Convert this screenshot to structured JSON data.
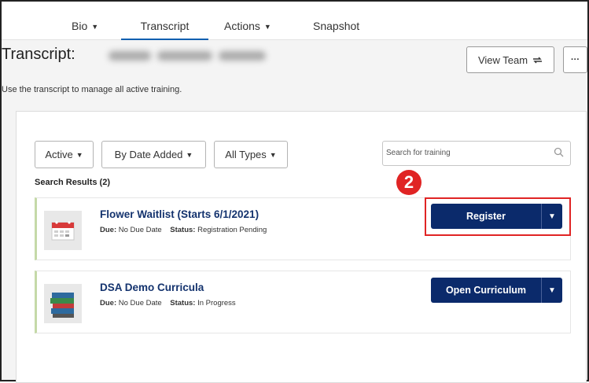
{
  "nav": {
    "items": [
      {
        "label": "Bio",
        "has_caret": true
      },
      {
        "label": "Transcript",
        "has_caret": false,
        "active": true
      },
      {
        "label": "Actions",
        "has_caret": true
      },
      {
        "label": "Snapshot",
        "has_caret": false
      }
    ]
  },
  "header": {
    "title": "Transcript:",
    "view_team_label": "View Team",
    "more_label": "···",
    "description": "Use the transcript to manage all active training."
  },
  "filters": {
    "status": "Active",
    "sort": "By Date Added",
    "type": "All Types"
  },
  "search": {
    "placeholder": "Search for training"
  },
  "results": {
    "label": "Search Results (2)",
    "items": [
      {
        "title": "Flower Waitlist (Starts 6/1/2021)",
        "due_label": "Due:",
        "due_value": "No Due Date",
        "status_label": "Status:",
        "status_value": "Registration Pending",
        "action_label": "Register",
        "icon": "calendar-icon"
      },
      {
        "title": "DSA Demo Curricula",
        "due_label": "Due:",
        "due_value": "No Due Date",
        "status_label": "Status:",
        "status_value": "In Progress",
        "action_label": "Open Curriculum",
        "icon": "books-icon"
      }
    ]
  },
  "annotation": {
    "step_number": "2"
  },
  "colors": {
    "accent_blue": "#0b2a6b",
    "title_blue": "#14336e",
    "highlight_red": "#e02424",
    "nav_underline": "#0d5fb0"
  }
}
